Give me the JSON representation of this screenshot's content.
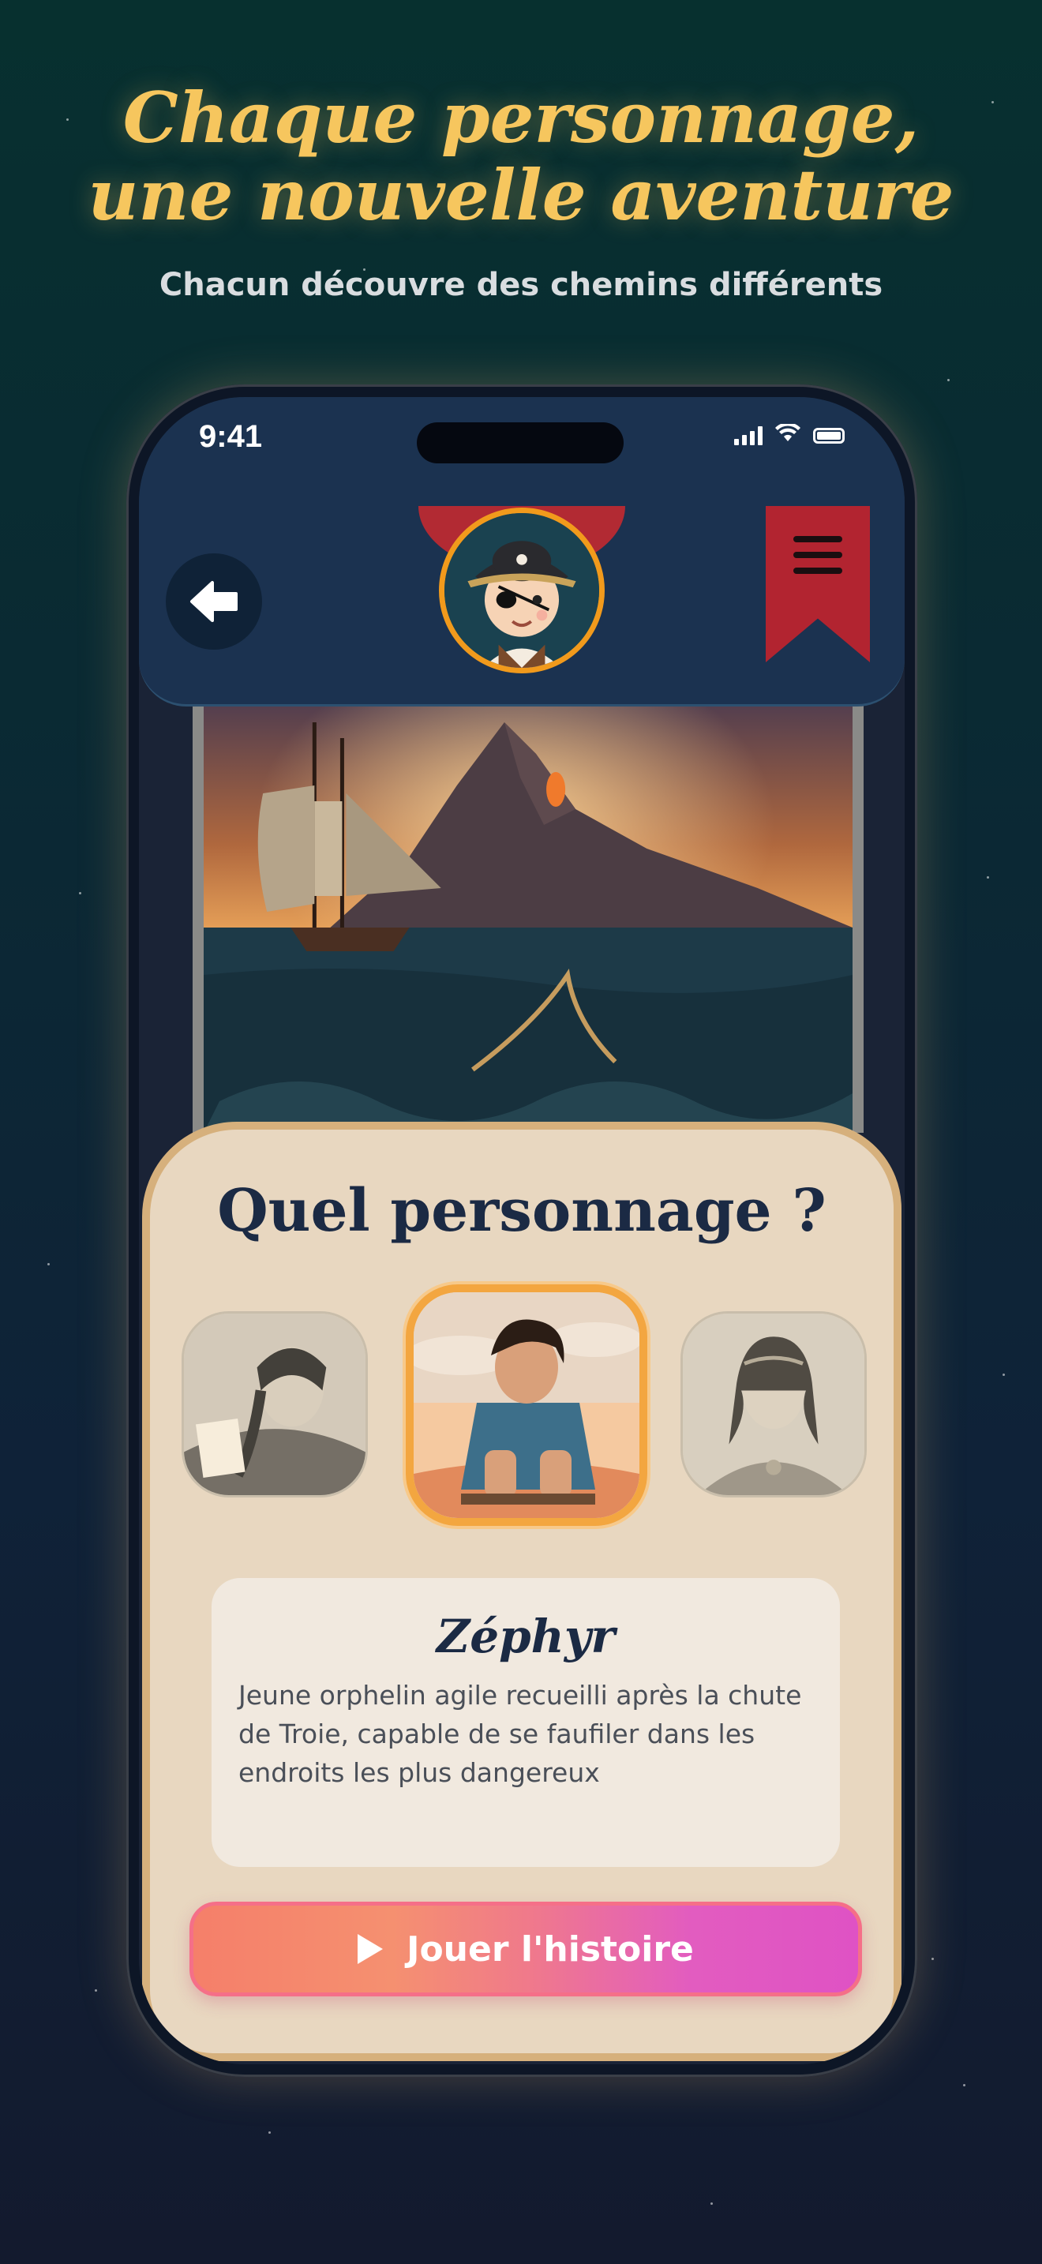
{
  "headline": {
    "line1": "Chaque personnage,",
    "line2": "une nouvelle aventure",
    "subtitle": "Chacun découvre des chemins différents"
  },
  "status_bar": {
    "time": "9:41",
    "icons": [
      "signal-icon",
      "wifi-icon",
      "battery-icon"
    ]
  },
  "header": {
    "back_icon": "arrow-left-icon",
    "avatar_icon": "pirate-avatar",
    "menu_icon": "hamburger-menu-icon"
  },
  "character_picker": {
    "title": "Quel personnage ?",
    "characters": [
      {
        "icon": "warrior-woman-portrait",
        "selected": false
      },
      {
        "icon": "young-boy-portrait",
        "selected": true
      },
      {
        "icon": "priestess-portrait",
        "selected": false
      }
    ],
    "selected_name": "Zéphyr",
    "selected_description": "Jeune orphelin agile recueilli après la chute de Troie, capable de se faufiler dans les endroits les plus dangereux"
  },
  "play_button": {
    "label": "Jouer l'histoire",
    "icon": "play-icon"
  },
  "colors": {
    "headline": "#f6c65e",
    "header_bg": "#1b3250",
    "card_bg": "#e8d7c0",
    "card_border": "#d6b07c",
    "accent_orange": "#f3a640",
    "bookmark_red": "#b22430",
    "play_gradient_start": "#f57f6a",
    "play_gradient_end": "#df52c4"
  }
}
